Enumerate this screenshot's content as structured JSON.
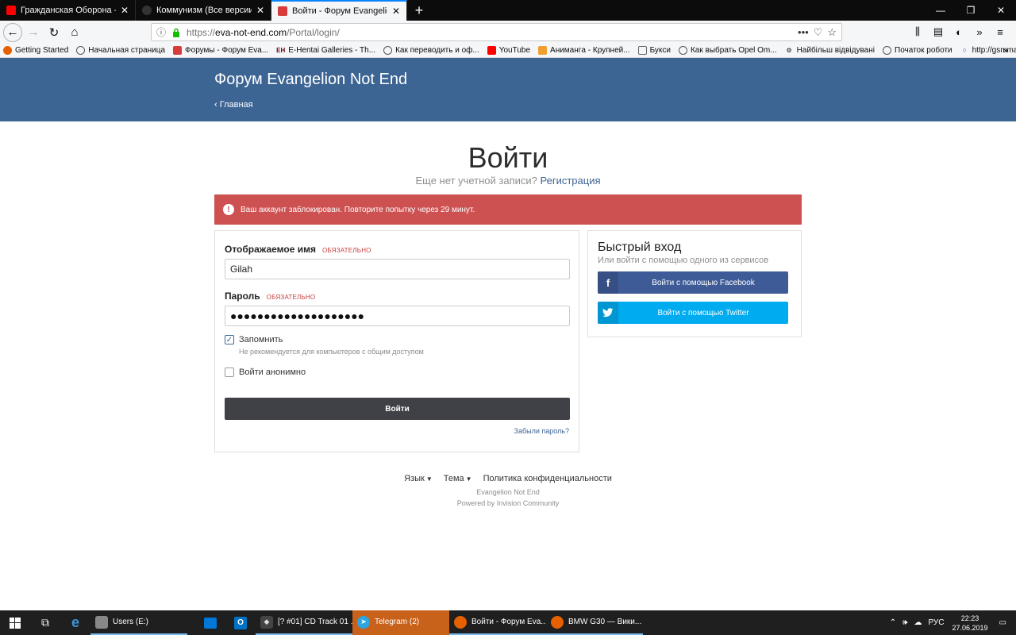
{
  "browser": {
    "tabs": [
      {
        "title": "Гражданская Оборона - Всё Н",
        "favicon_color": "#ff0000",
        "active": false
      },
      {
        "title": "Коммунизм (Все версии) в пр",
        "favicon_color": "#222222",
        "active": false
      },
      {
        "title": "Войти - Форум Evangelion Not",
        "favicon_color": "#d83b3b",
        "active": true
      }
    ],
    "new_tab_label": "+",
    "url": {
      "protocol": "https://",
      "host": "eva-not-end.com",
      "path": "/Portal/login/"
    },
    "bookmarks": [
      {
        "label": "Getting Started",
        "icon": "firefox-icon",
        "color": "#e66000"
      },
      {
        "label": "Начальная страница",
        "icon": "globe-icon",
        "color": "#555555"
      },
      {
        "label": "Форумы - Форум Eva...",
        "icon": "eva-icon",
        "color": "#d83b3b"
      },
      {
        "label": "E-Hentai Galleries - Th...",
        "icon": "eh-icon",
        "color": "#660611"
      },
      {
        "label": "Как переводить и оф...",
        "icon": "globe-icon",
        "color": "#555555"
      },
      {
        "label": "YouTube",
        "icon": "youtube-icon",
        "color": "#ff0000"
      },
      {
        "label": "Анимангa - Крупней...",
        "icon": "animanga-icon",
        "color": "#f0a030"
      },
      {
        "label": "Букси",
        "icon": "folder-icon",
        "color": "#666666"
      },
      {
        "label": "Как выбрать Opel Om...",
        "icon": "globe-icon",
        "color": "#555555"
      },
      {
        "label": "Найбільш відвідувані",
        "icon": "gear-icon",
        "color": "#555555"
      },
      {
        "label": "Початок роботи",
        "icon": "globe-icon",
        "color": "#555555"
      },
      {
        "label": "http://gsmmabila.nar...",
        "icon": "diamond-icon",
        "color": "#5b7bd5"
      }
    ]
  },
  "site": {
    "title": "Форум Evangelion Not End",
    "back_link": "Главная"
  },
  "login": {
    "heading": "Войти",
    "no_account_text": "Еще нет учетной записи?",
    "register_link": "Регистрация",
    "alert": "Ваш аккаунт заблокирован. Повторите попытку через 29 минут.",
    "username_label": "Отображаемое имя",
    "required_label": "обязательно",
    "username_value": "Gilah",
    "password_label": "Пароль",
    "password_value": "●●●●●●●●●●●●●●●●●●●●",
    "remember_label": "Запомнить",
    "remember_checked": true,
    "remember_hint": "Не рекомендуется для компьютеров с общим доступом",
    "anon_label": "Войти анонимно",
    "anon_checked": false,
    "submit_label": "Войти",
    "forgot_link": "Забыли пароль?"
  },
  "quick_login": {
    "title": "Быстрый вход",
    "subtitle": "Или войти с помощью одного из сервисов",
    "facebook_label": "Войти с помощью Facebook",
    "twitter_label": "Войти с помощью Twitter"
  },
  "footer": {
    "language": "Язык",
    "theme": "Тема",
    "privacy": "Политика конфиденциальности",
    "site_name": "Evangelion Not End",
    "powered_by": "Powered by Invision Community"
  },
  "taskbar": {
    "items": [
      {
        "label": "Users (E:)",
        "icon": "drive-icon",
        "color": "#888888",
        "state": "open"
      },
      {
        "label": "",
        "icon": "store-icon",
        "color": "#0078d7",
        "state": "pinned"
      },
      {
        "label": "",
        "icon": "outlook-icon",
        "color": "#0072c6",
        "state": "pinned"
      },
      {
        "label": "[? #01] CD Track 01 ...",
        "icon": "foobar-icon",
        "color": "#bbbbbb",
        "state": "open"
      },
      {
        "label": "Telegram (2)",
        "icon": "telegram-icon",
        "color": "#2ca5e0",
        "state": "active"
      },
      {
        "label": "Войти - Форум Eva...",
        "icon": "firefox-icon",
        "color": "#e66000",
        "state": "open"
      },
      {
        "label": "BMW G30 — Вики...",
        "icon": "firefox-icon",
        "color": "#e66000",
        "state": "open"
      }
    ],
    "language": "РУС",
    "time": "22:23",
    "date": "27.06.2019"
  }
}
